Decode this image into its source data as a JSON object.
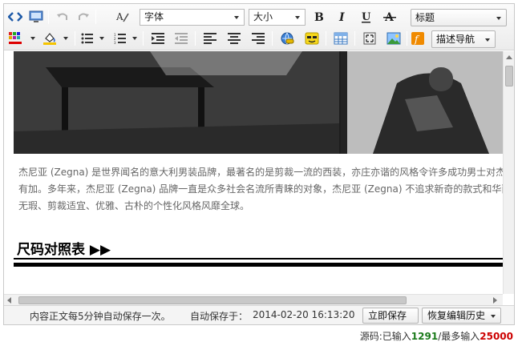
{
  "toolbar": {
    "font_family": "字体",
    "font_size": "大小",
    "heading": "标题",
    "describe_nav": "描述导航",
    "accent": "#1e5aa8"
  },
  "content": {
    "paragraph_lines": [
      "杰尼亚 (Zegna) 是世界闻名的意大利男装品牌，最著名的是剪裁一流的西装，亦庄亦谐的风格令许多成功男士对杰尼亚",
      "有加。多年来，杰尼亚 (Zegna) 品牌一直是众多社会名流所青睐的对象，杰尼亚 (Zegna) 不追求新奇的款式和华丽的",
      "无瑕、剪裁适宜、优雅、古朴的个性化风格风靡全球。"
    ],
    "section_heading": "尺码对照表 ▶▶"
  },
  "statusbar": {
    "autosave_hint": "内容正文每5分钟自动保存一次。",
    "autosave_at_label": "自动保存于：",
    "autosave_time": "2014-02-20 16:13:20",
    "save_now": "立即保存",
    "restore_history": "恢复编辑历史"
  },
  "counter": {
    "prefix": "源码:已输入",
    "current": "1291",
    "separator": "/最多输入",
    "max": "25000"
  }
}
